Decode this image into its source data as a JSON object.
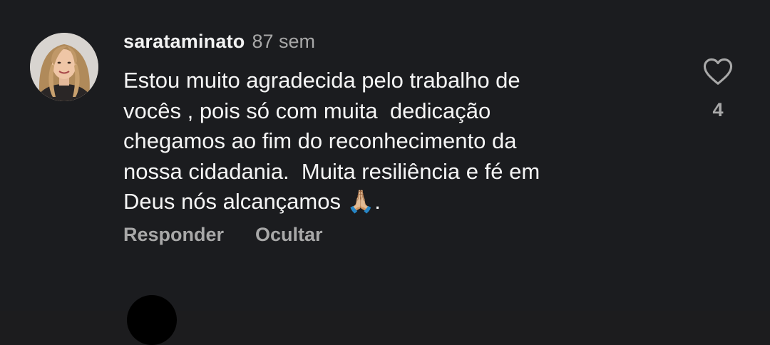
{
  "comment": {
    "username": "sarataminato",
    "time": "87 sem",
    "text": "Estou muito agradecida pelo trabalho de\nvocês , pois só com muita  dedicação\nchegamos ao fim do reconhecimento da\nnossa cidadania.  Muita resiliência e fé em\nDeus nós alcançamos 🙏🏼.",
    "like_count": "4",
    "reply_label": "Responder",
    "hide_label": "Ocultar"
  },
  "icons": {
    "like": "heart-outline-icon",
    "avatar": "user-avatar"
  },
  "colors": {
    "background": "#1b1c1f",
    "primary_text": "#f5f5f5",
    "secondary_text": "#a8a8a8"
  }
}
